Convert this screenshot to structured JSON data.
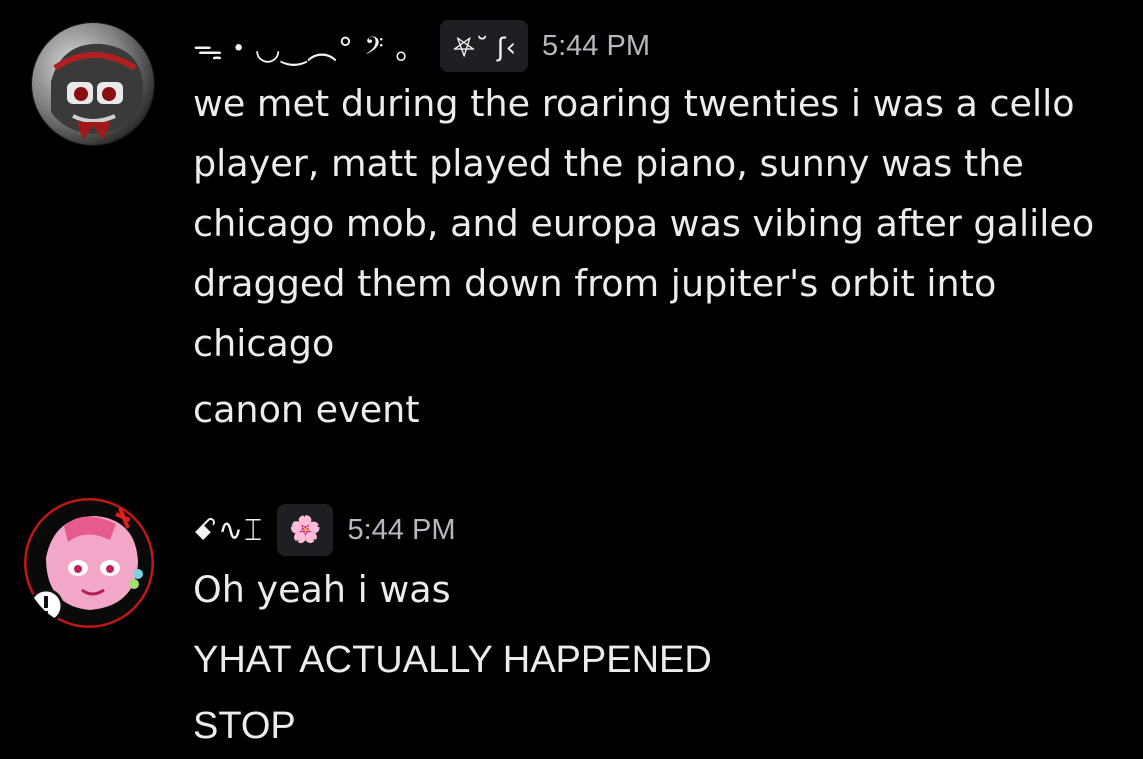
{
  "messages": [
    {
      "username": "ᯓ・◡‿︵° 𝄢 。",
      "badge": "𖤐˘ ʃ‹",
      "timestamp": "5:44 PM",
      "lines": [
        "we met during the roaring twenties i was a cello",
        "player, matt played the piano, sunny was the",
        "chicago mob, and europa was vibing after galileo",
        "dragged them down from jupiter's orbit into",
        "chicago",
        "canon event"
      ]
    },
    {
      "username": "ꗃ∿⌶",
      "badge": "🌸",
      "timestamp": "5:44 PM",
      "lines": [
        "Oh yeah i was",
        "YHAT ACTUALLY HAPPENED",
        "STOP"
      ]
    }
  ],
  "colors": {
    "background": "#000000",
    "text": "#ececef",
    "timestamp": "#b5b8bf",
    "badge_bg": "#1e1f22"
  }
}
